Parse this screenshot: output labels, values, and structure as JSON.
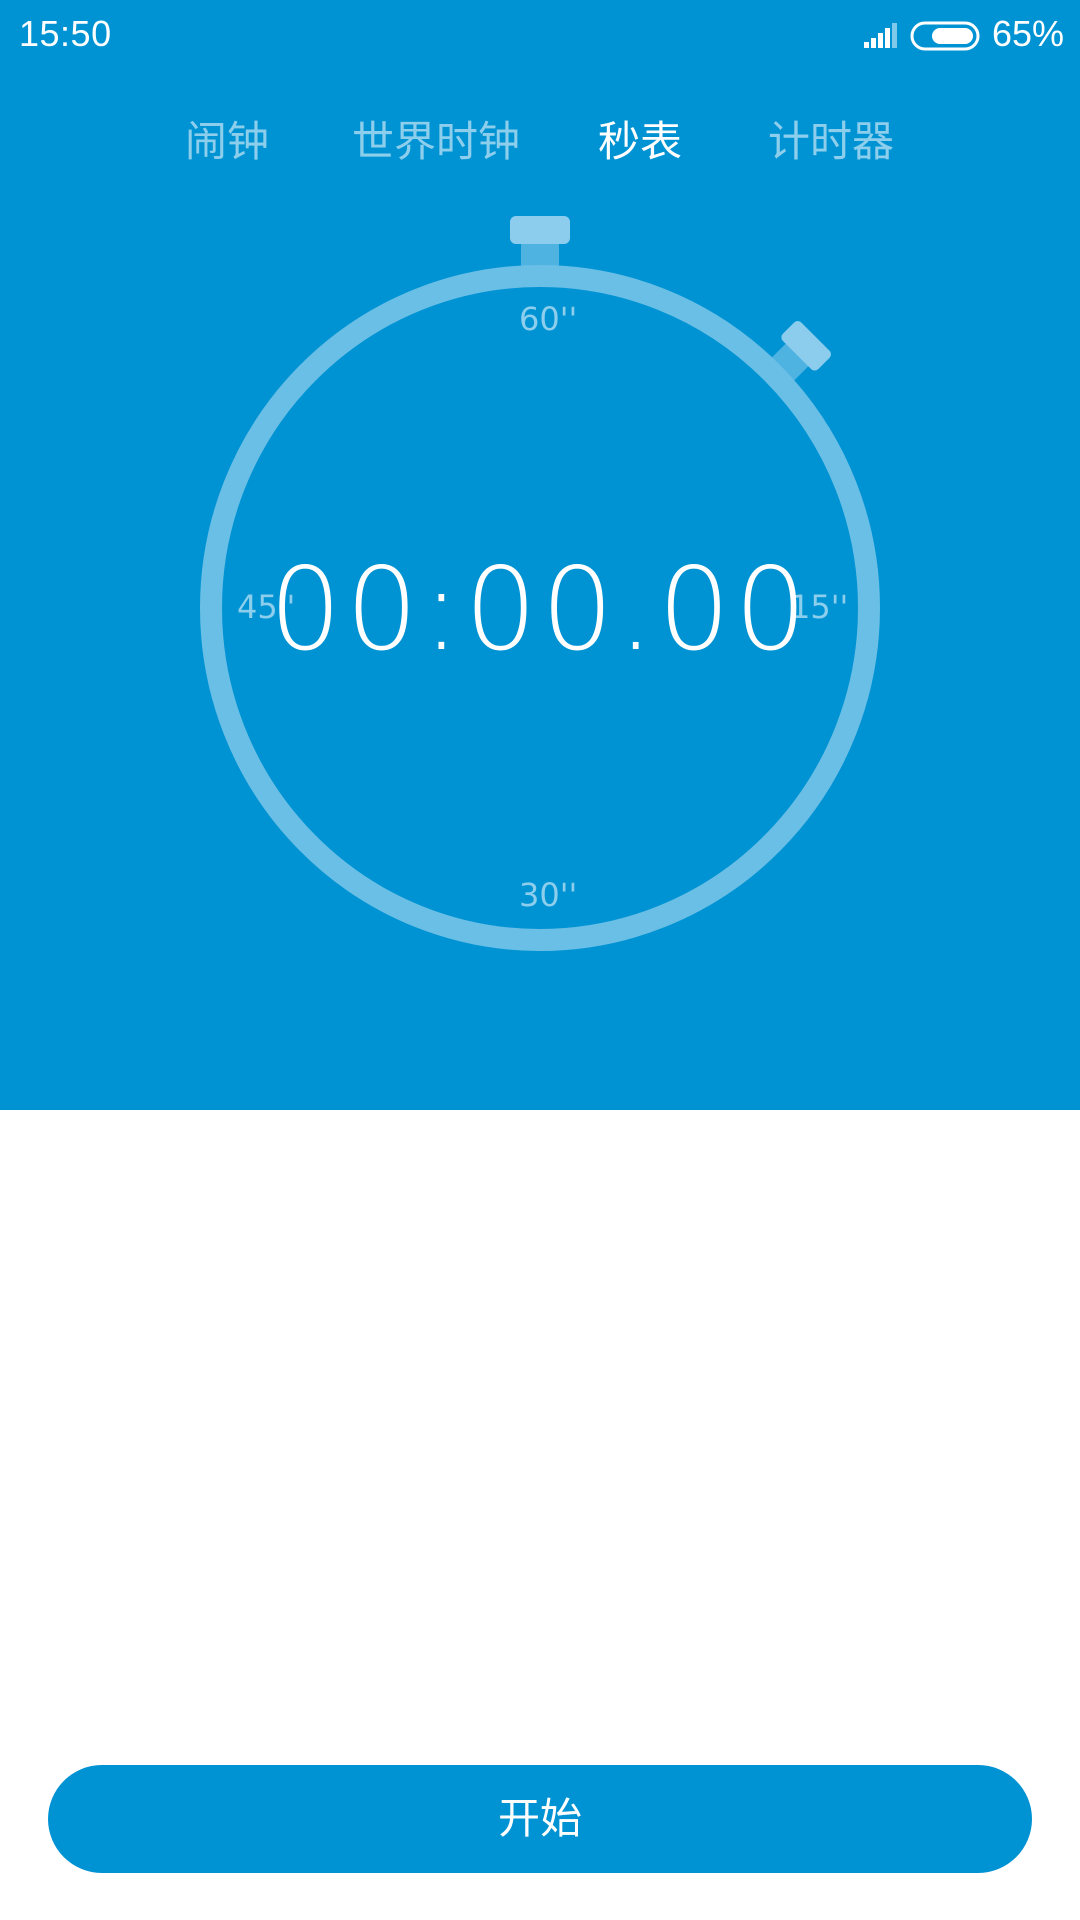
{
  "status_bar": {
    "time": "15:50",
    "battery_percent": "65%",
    "battery_level": 0.65,
    "signal_icon": "signal-icon",
    "battery_icon": "battery-icon"
  },
  "tabs": [
    {
      "label": "闹钟",
      "active": false
    },
    {
      "label": "世界时钟",
      "active": false
    },
    {
      "label": "秒表",
      "active": true
    },
    {
      "label": "计时器",
      "active": false
    }
  ],
  "stopwatch": {
    "display": "00:00.00",
    "marks": {
      "top": "60''",
      "right": "15''",
      "bottom": "30''",
      "left": "45''"
    }
  },
  "start_button": {
    "label": "开始"
  },
  "colors": {
    "primary": "#0093d3",
    "ring": "#6abfe6",
    "background": "#ffffff"
  }
}
